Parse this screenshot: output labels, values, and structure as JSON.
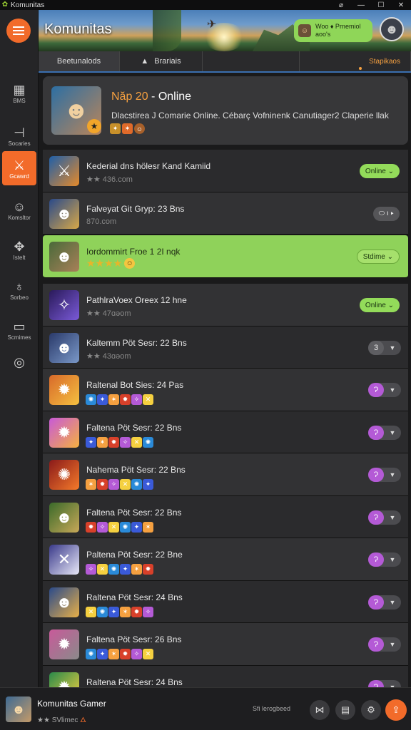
{
  "window": {
    "title": "Komunitas"
  },
  "sidebar": {
    "items": [
      {
        "label": "BMS",
        "icon": "grid-icon"
      },
      {
        "label": "Socaries",
        "icon": "sliders-icon"
      },
      {
        "label": "Gcawrd",
        "icon": "gamepad-icon",
        "active": true
      },
      {
        "label": "Komsltor",
        "icon": "user-icon"
      },
      {
        "label": "Istelt",
        "icon": "puzzle-icon"
      },
      {
        "label": "Sorbeo",
        "icon": "notification-icon"
      },
      {
        "label": "Scmimes",
        "icon": "image-icon"
      },
      {
        "label": "",
        "icon": "target-icon"
      }
    ]
  },
  "header": {
    "title": "Komunitas",
    "promo_line1": "Woo ♦ Prnemiol",
    "promo_line2": "aoo's"
  },
  "tabs": [
    {
      "label": "Beetunalods"
    },
    {
      "label": "Brariais"
    },
    {
      "label": ""
    },
    {
      "label": "Stapikaos"
    }
  ],
  "featured": {
    "title_prefix": "Năp 20",
    "title_suffix": "- Online",
    "description": "Dlacstirea J Comarie Online. Cébarç Vofninenk Canutiager2 Claperie llak"
  },
  "rows": [
    {
      "name": "Kederial dns hölesr Kand Kamiid",
      "sub": "★★ 436.com",
      "status": "Online ⌄",
      "status_type": "green",
      "avatar_icon": "gamepad-icon",
      "avatar_colors": [
        "#1f5fa8",
        "#e58a2a"
      ]
    },
    {
      "name": "Falveyat Git Gryp: 23 Bns",
      "sub": "870.com",
      "status": "⬭ ı ▸",
      "status_type": "gray",
      "avatar_icon": "soldier-icon",
      "avatar_colors": [
        "#2a4a8a",
        "#d8a848"
      ]
    },
    {
      "name": "Iordommirt Froe 1 2I nqk",
      "sub": "★★★★",
      "status": "Stdime ⌄",
      "status_type": "highlight",
      "avatar_icon": "soldier-icon",
      "avatar_colors": [
        "#4a6a3a",
        "#a88058"
      ]
    },
    {
      "name": "PathlraVoex Oreex 12 hne",
      "sub": "★★ 47ɑəom",
      "status": "Online ⌄",
      "status_type": "green",
      "avatar_icon": "sword-icon",
      "avatar_colors": [
        "#2a1a5a",
        "#7a5ad8"
      ]
    },
    {
      "name": "Kaltemm Pöt Sesr: 22 Bns",
      "sub": "★★ 43ɑəom",
      "status": "3",
      "status_type": "grayn",
      "avatar_icon": "soldier-icon",
      "avatar_colors": [
        "#2a3a6a",
        "#7a98c8"
      ]
    },
    {
      "name": "Raltenal Bot Sies: 24 Pas",
      "sub": "",
      "status": "Ɂ",
      "status_type": "purple",
      "avatar_icon": "gun-icon",
      "avatar_colors": [
        "#d86a2a",
        "#f5c040"
      ]
    },
    {
      "name": "Faltena Pöt Sesr: 22 Bns",
      "sub": "",
      "status": "Ɂ",
      "status_type": "purple",
      "avatar_icon": "gun-icon",
      "avatar_colors": [
        "#c85ad8",
        "#f5b040"
      ]
    },
    {
      "name": "Nahema Pöt Sesr: 22 Bns",
      "sub": "",
      "status": "Ɂ",
      "status_type": "purple",
      "avatar_icon": "fire-icon",
      "avatar_colors": [
        "#8a1a1a",
        "#f57a2a"
      ]
    },
    {
      "name": "Faltena Pöt Sesr: 22 Bns",
      "sub": "",
      "status": "Ɂ",
      "status_type": "purple",
      "avatar_icon": "soldier-icon",
      "avatar_colors": [
        "#3a6a2a",
        "#c8a858"
      ]
    },
    {
      "name": "Paltena Pöt Sesr: 22 Bne",
      "sub": "",
      "status": "Ɂ",
      "status_type": "purple",
      "avatar_icon": "cross-icon",
      "avatar_colors": [
        "#3a3a8a",
        "#e8e8f8"
      ]
    },
    {
      "name": "Raltena Pöt Sesr: 24 Bns",
      "sub": "",
      "status": "Ɂ",
      "status_type": "purple",
      "avatar_icon": "soldier-icon",
      "avatar_colors": [
        "#2a4a8a",
        "#e8b048"
      ]
    },
    {
      "name": "Faltena Pöt Sesr: 26 Bns",
      "sub": "",
      "status": "Ɂ",
      "status_type": "purple",
      "avatar_icon": "gun-icon",
      "avatar_colors": [
        "#c85a9a",
        "#8a8a8a"
      ]
    },
    {
      "name": "Raltena Pöt Sesr: 24 Bns",
      "sub": "",
      "status": "Ɂ",
      "status_type": "purple",
      "avatar_icon": "gun-icon",
      "avatar_colors": [
        "#2a8a4a",
        "#f5d040"
      ]
    }
  ],
  "mini_icon_colors": [
    "#3a5ad8",
    "#f5a040",
    "#d8402a",
    "#b45ad6",
    "#f5d040",
    "#2a8ad8"
  ],
  "bottom": {
    "user_name": "Komunitas Gamer",
    "user_status": "★★ SVlimec",
    "sync_label": "Sfi lerogbeed"
  },
  "colors": {
    "accent": "#f26b2a",
    "online": "#93db5a",
    "highlight_row": "#8fd25a",
    "badge": "#b45ad6"
  }
}
